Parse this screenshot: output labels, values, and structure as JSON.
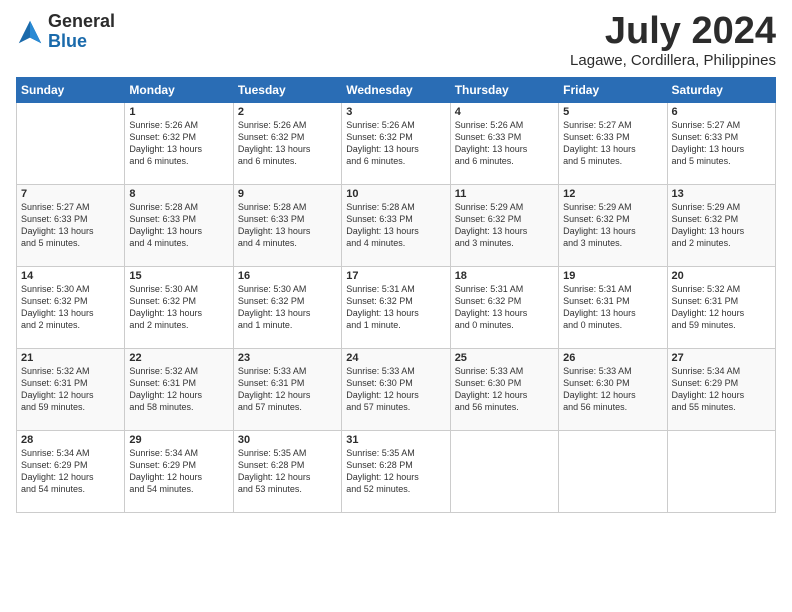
{
  "header": {
    "logo_general": "General",
    "logo_blue": "Blue",
    "month_title": "July 2024",
    "location": "Lagawe, Cordillera, Philippines"
  },
  "days_of_week": [
    "Sunday",
    "Monday",
    "Tuesday",
    "Wednesday",
    "Thursday",
    "Friday",
    "Saturday"
  ],
  "weeks": [
    [
      {
        "day": "",
        "info": ""
      },
      {
        "day": "1",
        "info": "Sunrise: 5:26 AM\nSunset: 6:32 PM\nDaylight: 13 hours\nand 6 minutes."
      },
      {
        "day": "2",
        "info": "Sunrise: 5:26 AM\nSunset: 6:32 PM\nDaylight: 13 hours\nand 6 minutes."
      },
      {
        "day": "3",
        "info": "Sunrise: 5:26 AM\nSunset: 6:32 PM\nDaylight: 13 hours\nand 6 minutes."
      },
      {
        "day": "4",
        "info": "Sunrise: 5:26 AM\nSunset: 6:33 PM\nDaylight: 13 hours\nand 6 minutes."
      },
      {
        "day": "5",
        "info": "Sunrise: 5:27 AM\nSunset: 6:33 PM\nDaylight: 13 hours\nand 5 minutes."
      },
      {
        "day": "6",
        "info": "Sunrise: 5:27 AM\nSunset: 6:33 PM\nDaylight: 13 hours\nand 5 minutes."
      }
    ],
    [
      {
        "day": "7",
        "info": "Sunrise: 5:27 AM\nSunset: 6:33 PM\nDaylight: 13 hours\nand 5 minutes."
      },
      {
        "day": "8",
        "info": "Sunrise: 5:28 AM\nSunset: 6:33 PM\nDaylight: 13 hours\nand 4 minutes."
      },
      {
        "day": "9",
        "info": "Sunrise: 5:28 AM\nSunset: 6:33 PM\nDaylight: 13 hours\nand 4 minutes."
      },
      {
        "day": "10",
        "info": "Sunrise: 5:28 AM\nSunset: 6:33 PM\nDaylight: 13 hours\nand 4 minutes."
      },
      {
        "day": "11",
        "info": "Sunrise: 5:29 AM\nSunset: 6:32 PM\nDaylight: 13 hours\nand 3 minutes."
      },
      {
        "day": "12",
        "info": "Sunrise: 5:29 AM\nSunset: 6:32 PM\nDaylight: 13 hours\nand 3 minutes."
      },
      {
        "day": "13",
        "info": "Sunrise: 5:29 AM\nSunset: 6:32 PM\nDaylight: 13 hours\nand 2 minutes."
      }
    ],
    [
      {
        "day": "14",
        "info": "Sunrise: 5:30 AM\nSunset: 6:32 PM\nDaylight: 13 hours\nand 2 minutes."
      },
      {
        "day": "15",
        "info": "Sunrise: 5:30 AM\nSunset: 6:32 PM\nDaylight: 13 hours\nand 2 minutes."
      },
      {
        "day": "16",
        "info": "Sunrise: 5:30 AM\nSunset: 6:32 PM\nDaylight: 13 hours\nand 1 minute."
      },
      {
        "day": "17",
        "info": "Sunrise: 5:31 AM\nSunset: 6:32 PM\nDaylight: 13 hours\nand 1 minute."
      },
      {
        "day": "18",
        "info": "Sunrise: 5:31 AM\nSunset: 6:32 PM\nDaylight: 13 hours\nand 0 minutes."
      },
      {
        "day": "19",
        "info": "Sunrise: 5:31 AM\nSunset: 6:31 PM\nDaylight: 13 hours\nand 0 minutes."
      },
      {
        "day": "20",
        "info": "Sunrise: 5:32 AM\nSunset: 6:31 PM\nDaylight: 12 hours\nand 59 minutes."
      }
    ],
    [
      {
        "day": "21",
        "info": "Sunrise: 5:32 AM\nSunset: 6:31 PM\nDaylight: 12 hours\nand 59 minutes."
      },
      {
        "day": "22",
        "info": "Sunrise: 5:32 AM\nSunset: 6:31 PM\nDaylight: 12 hours\nand 58 minutes."
      },
      {
        "day": "23",
        "info": "Sunrise: 5:33 AM\nSunset: 6:31 PM\nDaylight: 12 hours\nand 57 minutes."
      },
      {
        "day": "24",
        "info": "Sunrise: 5:33 AM\nSunset: 6:30 PM\nDaylight: 12 hours\nand 57 minutes."
      },
      {
        "day": "25",
        "info": "Sunrise: 5:33 AM\nSunset: 6:30 PM\nDaylight: 12 hours\nand 56 minutes."
      },
      {
        "day": "26",
        "info": "Sunrise: 5:33 AM\nSunset: 6:30 PM\nDaylight: 12 hours\nand 56 minutes."
      },
      {
        "day": "27",
        "info": "Sunrise: 5:34 AM\nSunset: 6:29 PM\nDaylight: 12 hours\nand 55 minutes."
      }
    ],
    [
      {
        "day": "28",
        "info": "Sunrise: 5:34 AM\nSunset: 6:29 PM\nDaylight: 12 hours\nand 54 minutes."
      },
      {
        "day": "29",
        "info": "Sunrise: 5:34 AM\nSunset: 6:29 PM\nDaylight: 12 hours\nand 54 minutes."
      },
      {
        "day": "30",
        "info": "Sunrise: 5:35 AM\nSunset: 6:28 PM\nDaylight: 12 hours\nand 53 minutes."
      },
      {
        "day": "31",
        "info": "Sunrise: 5:35 AM\nSunset: 6:28 PM\nDaylight: 12 hours\nand 52 minutes."
      },
      {
        "day": "",
        "info": ""
      },
      {
        "day": "",
        "info": ""
      },
      {
        "day": "",
        "info": ""
      }
    ]
  ]
}
